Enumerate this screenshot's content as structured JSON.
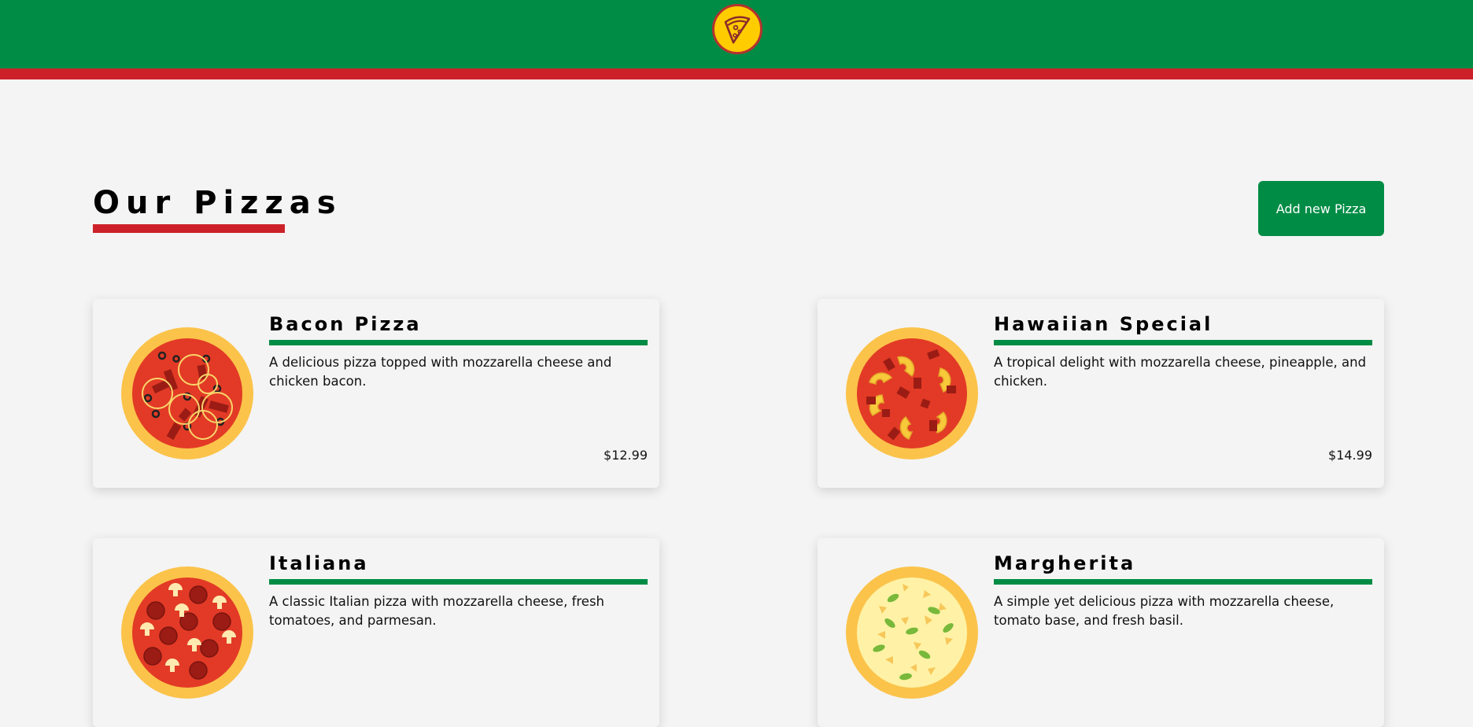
{
  "header": {
    "logo_icon": "pizza-slice-icon",
    "colors": {
      "green": "#008c45",
      "red": "#cd212a",
      "yellow": "#ffcc00"
    }
  },
  "main": {
    "title": "Our Pizzas",
    "add_button_label": "Add new Pizza"
  },
  "pizzas": [
    {
      "name": "Bacon Pizza",
      "description": "A delicious pizza topped with mozzarella cheese and chicken bacon.",
      "price": "$12.99",
      "image_icon": "bacon-pizza-icon"
    },
    {
      "name": "Hawaiian Special",
      "description": "A tropical delight with mozzarella cheese, pineapple, and chicken.",
      "price": "$14.99",
      "image_icon": "hawaiian-pizza-icon"
    },
    {
      "name": "Italiana",
      "description": "A classic Italian pizza with mozzarella cheese, fresh tomatoes, and parmesan.",
      "price": "",
      "image_icon": "italiana-pizza-icon"
    },
    {
      "name": "Margherita",
      "description": "A simple yet delicious pizza with mozzarella cheese, tomato base, and fresh basil.",
      "price": "",
      "image_icon": "margherita-pizza-icon"
    }
  ]
}
